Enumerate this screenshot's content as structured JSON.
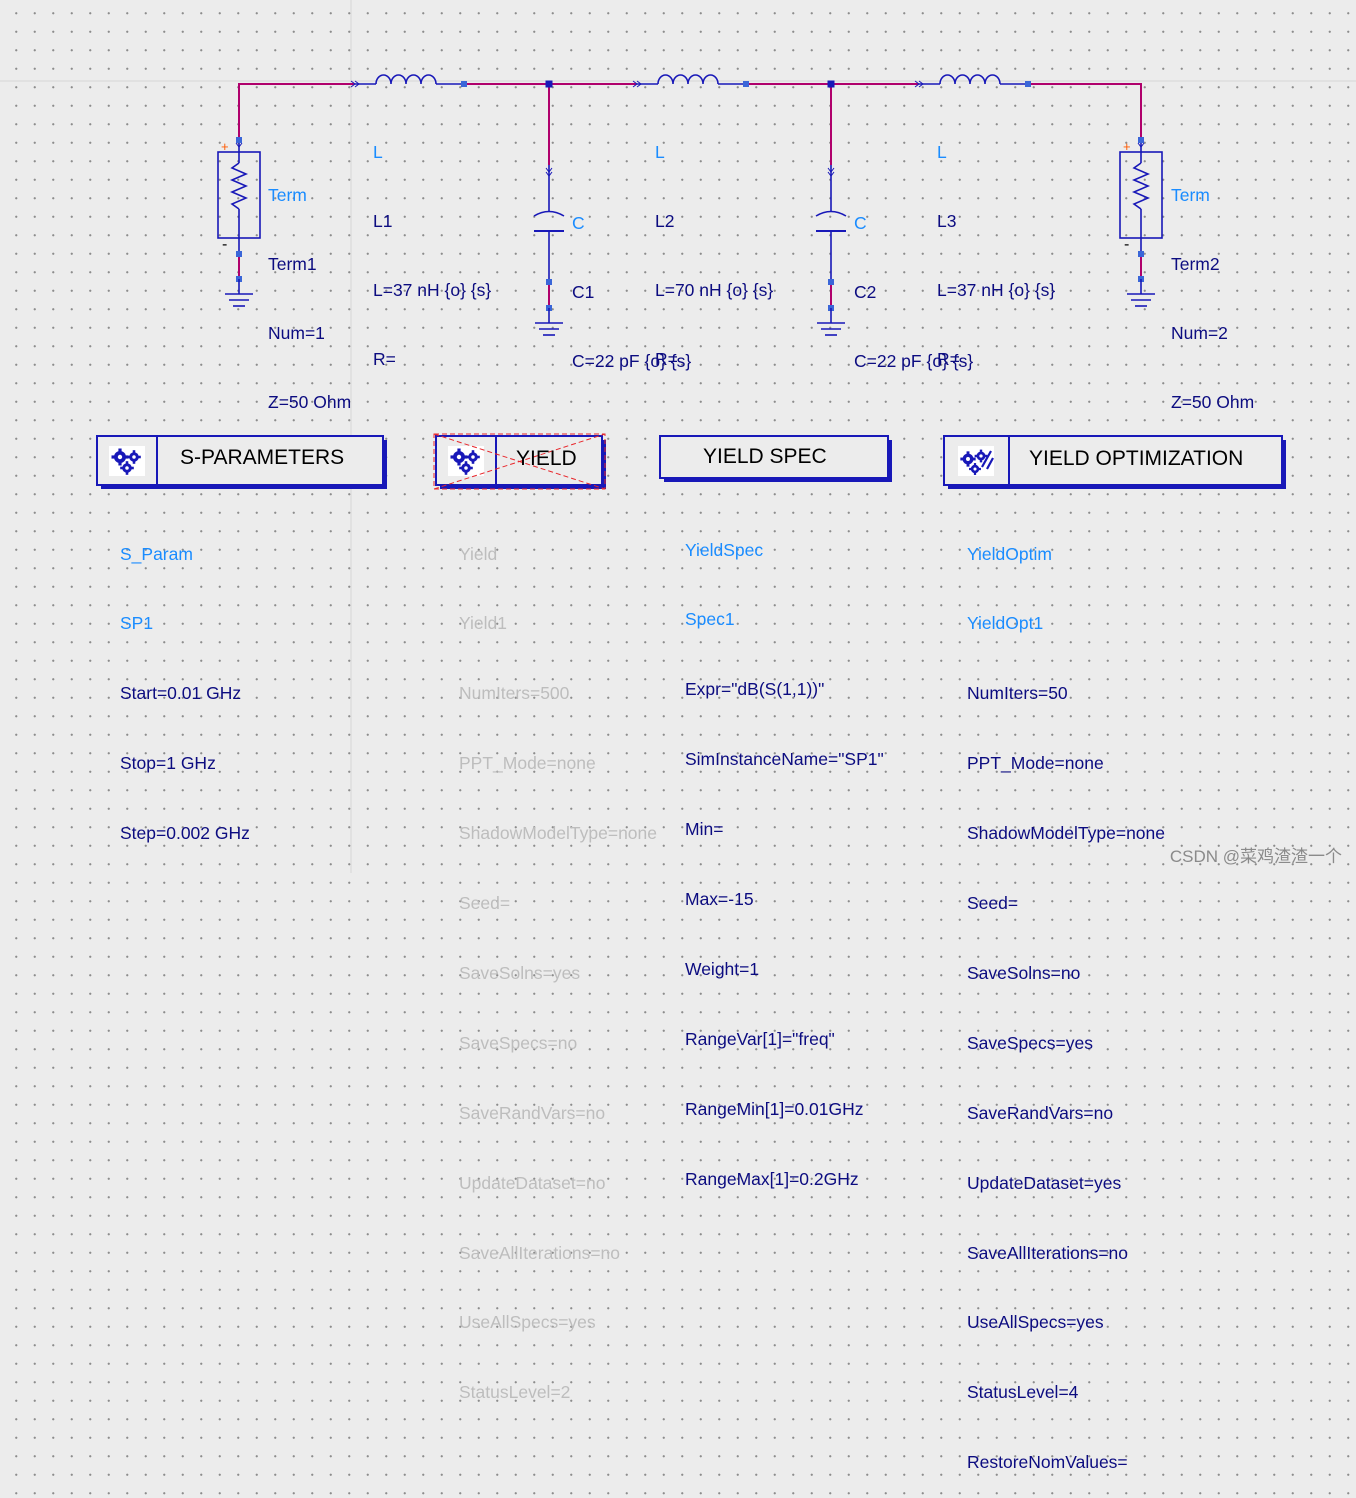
{
  "colors": {
    "wire": "#b0006c",
    "component": "#1818b8",
    "label_blue": "#1a8cff",
    "param": "#0c0c80",
    "disabled": "#bdbdbd",
    "pin": "#3a66d8",
    "plus": "#ff5a00"
  },
  "schematic": {
    "inductors": [
      {
        "type": "L",
        "name": "L1",
        "params": [
          "L=37 nH {o} {s}",
          "R="
        ]
      },
      {
        "type": "L",
        "name": "L2",
        "params": [
          "L=70 nH {o} {s}",
          "R="
        ]
      },
      {
        "type": "L",
        "name": "L3",
        "params": [
          "L=37 nH {o} {s}",
          "R="
        ]
      }
    ],
    "capacitors": [
      {
        "type": "C",
        "name": "C1",
        "params": [
          "C=22 pF {o} {s}"
        ]
      },
      {
        "type": "C",
        "name": "C2",
        "params": [
          "C=22 pF {o} {s}"
        ]
      }
    ],
    "terms": [
      {
        "type": "Term",
        "name": "Term1",
        "params": [
          "Num=1",
          "Z=50 Ohm"
        ],
        "plus": "+",
        "minus": "-"
      },
      {
        "type": "Term",
        "name": "Term2",
        "params": [
          "Num=2",
          "Z=50 Ohm"
        ],
        "plus": "+",
        "minus": "-"
      }
    ]
  },
  "controllers": [
    {
      "title": "S-PARAMETERS",
      "icon": "gears-icon",
      "type": "S_Param",
      "name": "SP1",
      "params": [
        "Start=0.01 GHz",
        "Stop=1 GHz",
        "Step=0.002 GHz"
      ],
      "disabled": false
    },
    {
      "title": "YIELD",
      "icon": "gears-icon",
      "type": "Yield",
      "name": "Yield1",
      "params": [
        "NumIters=500",
        "PPT_Mode=none",
        "ShadowModelType=none",
        "Seed=",
        "SaveSolns=yes",
        "SaveSpecs=no",
        "SaveRandVars=no",
        "UpdateDataset=no",
        "SaveAllIterations=no",
        "UseAllSpecs=yes",
        "StatusLevel=2"
      ],
      "disabled": true
    },
    {
      "title": "YIELD SPEC",
      "icon": "",
      "type": "YieldSpec",
      "name": "Spec1",
      "params": [
        "Expr=\"dB(S(1,1))\"",
        "SimInstanceName=\"SP1\"",
        "Min=",
        "Max=-15",
        "Weight=1",
        "RangeVar[1]=\"freq\"",
        "RangeMin[1]=0.01GHz",
        "RangeMax[1]=0.2GHz"
      ],
      "disabled": false
    },
    {
      "title": "YIELD OPTIMIZATION",
      "icon": "gears-wrench-icon",
      "type": "YieldOptim",
      "name": "YieldOpt1",
      "params": [
        "NumIters=50",
        "PPT_Mode=none",
        "ShadowModelType=none",
        "Seed=",
        "SaveSolns=no",
        "SaveSpecs=yes",
        "SaveRandVars=no",
        "UpdateDataset=yes",
        "SaveAllIterations=no",
        "UseAllSpecs=yes",
        "StatusLevel=4",
        "RestoreNomValues="
      ],
      "disabled": false
    }
  ],
  "watermark": "CSDN @菜鸡渣渣一个"
}
